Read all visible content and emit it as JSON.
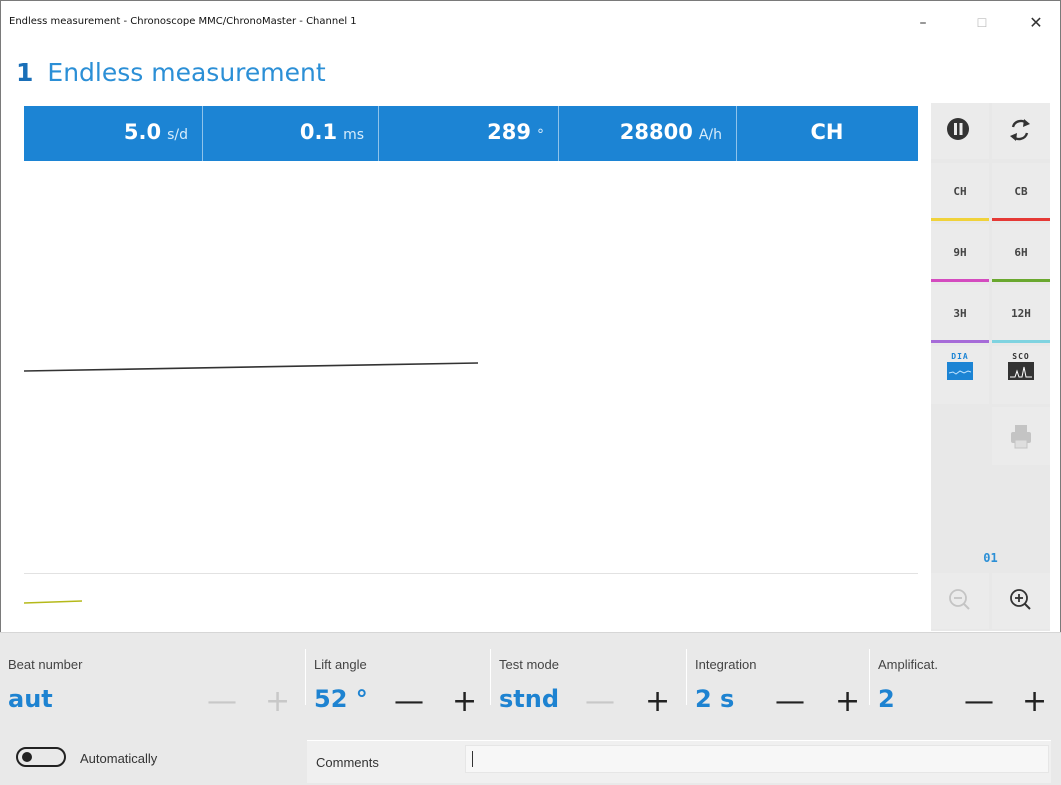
{
  "window": {
    "title": "Endless measurement - Chronoscope MMC/ChronoMaster - Channel 1",
    "minimize_symbol": "–",
    "maximize_symbol": "☐",
    "close_symbol": "✕"
  },
  "header": {
    "number": "1",
    "title": "Endless measurement"
  },
  "readouts": [
    {
      "value": "5.0",
      "unit": "s/d"
    },
    {
      "value": "0.1",
      "unit": "ms"
    },
    {
      "value": "289",
      "unit": "°"
    },
    {
      "value": "28800",
      "unit": "A/h"
    },
    {
      "value": "CH",
      "unit": ""
    }
  ],
  "sidebar": {
    "positions": [
      {
        "label": "CH",
        "color": "#f0d23a"
      },
      {
        "label": "CB",
        "color": "#e53935"
      },
      {
        "label": "9H",
        "color": "#d44bbf"
      },
      {
        "label": "6H",
        "color": "#6aa82f"
      },
      {
        "label": "3H",
        "color": "#a66bd8"
      },
      {
        "label": "12H",
        "color": "#7fd3e0"
      }
    ],
    "modes": [
      {
        "label": "DIA"
      },
      {
        "label": "SCO"
      }
    ],
    "zoom_level": "01",
    "icons": [
      "pause-icon",
      "refresh-icon",
      "print-icon",
      "zoom-out-icon",
      "zoom-in-icon"
    ]
  },
  "settings": {
    "beat_number": {
      "label": "Beat number",
      "value": "aut"
    },
    "lift_angle": {
      "label": "Lift angle",
      "value": "52 °"
    },
    "test_mode": {
      "label": "Test mode",
      "value": "stnd"
    },
    "integration": {
      "label": "Integration",
      "value": "2 s"
    },
    "amplification": {
      "label": "Amplificat.",
      "value": "2"
    },
    "minus": "—",
    "plus": "+"
  },
  "auto_toggle": {
    "label": "Automatically"
  },
  "comments": {
    "label": "Comments",
    "value": ""
  },
  "colors": {
    "accent": "#1c84d4",
    "value_text": "#1e83d1"
  }
}
